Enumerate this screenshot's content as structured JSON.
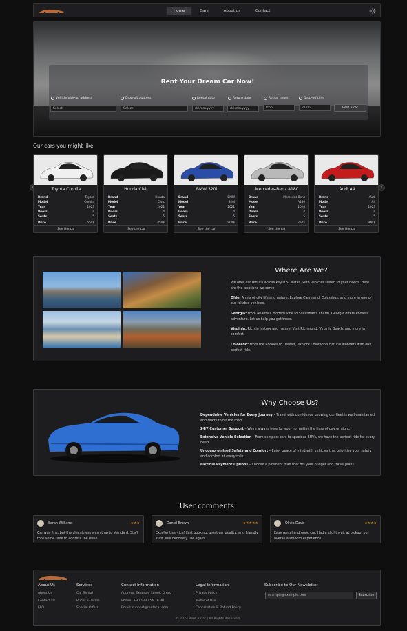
{
  "nav": {
    "links": [
      "Home",
      "Cars",
      "About us",
      "Contact"
    ],
    "active_index": 0
  },
  "hero": {
    "title": "Rent Your Dream Car Now!",
    "fields": [
      {
        "label": "Vehicle pick-up address",
        "value": "Select"
      },
      {
        "label": "Drop-off address",
        "value": "Select"
      },
      {
        "label": "Rental date",
        "value": "dd.mm.yyyy"
      },
      {
        "label": "Return date",
        "value": "dd.mm.yyyy"
      },
      {
        "label": "Rental hours",
        "value": "8:55"
      },
      {
        "label": "Drop-off time",
        "value": "21:05"
      }
    ],
    "button": "Rent a car"
  },
  "cars_section": {
    "heading": "Our cars you might like",
    "spec_labels": [
      "Brand",
      "Model",
      "Year",
      "Doors",
      "Seats",
      "Price"
    ],
    "see_label": "See the car",
    "cars": [
      {
        "name": "Toyota Corolla",
        "brand": "Toyota",
        "model": "Corolla",
        "year": "2023",
        "doors": "4",
        "seats": "5",
        "price": "550$",
        "color": "#f0f0f0"
      },
      {
        "name": "Honda Civic",
        "brand": "Honda",
        "model": "Civic",
        "year": "2022",
        "doors": "4",
        "seats": "5",
        "price": "450$",
        "color": "#1a1a1a"
      },
      {
        "name": "BMW 320i",
        "brand": "BMW",
        "model": "320i",
        "year": "2021",
        "doors": "4",
        "seats": "5",
        "price": "800$",
        "color": "#2a4ea8"
      },
      {
        "name": "Mercedes-Benz A180",
        "brand": "Mercedes-Benz",
        "model": "A180",
        "year": "2020",
        "doors": "4",
        "seats": "5",
        "price": "750$",
        "color": "#b9b9b9"
      },
      {
        "name": "Audi A4",
        "brand": "Audi",
        "model": "A4",
        "year": "2023",
        "doors": "4",
        "seats": "5",
        "price": "900$",
        "color": "#c41c1c"
      }
    ]
  },
  "where": {
    "heading": "Where Are We?",
    "intro": "We offer car rentals across key U.S. states, with vehicles suited to your needs. Here are the locations we serve:",
    "locations": [
      {
        "state": "Ohio:",
        "text": " A mix of city life and nature. Explore Cleveland, Columbus, and more in one of our reliable vehicles."
      },
      {
        "state": "Georgia:",
        "text": " From Atlanta's modern vibe to Savannah's charm, Georgia offers endless adventure. Let us help you get there."
      },
      {
        "state": "Virginia:",
        "text": " Rich in history and nature. Visit Richmond, Virginia Beach, and more in comfort."
      },
      {
        "state": "Colorado:",
        "text": " From the Rockies to Denver, explore Colorado's natural wonders with our perfect ride."
      }
    ]
  },
  "why": {
    "heading": "Why Choose Us?",
    "items": [
      {
        "title": "Dependable Vehicles for Every Journey",
        "text": " – Travel with confidence knowing our fleet is well-maintained and ready to hit the road."
      },
      {
        "title": "24/7 Customer Support",
        "text": " – We're always here for you, no matter the time of day or night."
      },
      {
        "title": "Extensive Vehicle Selection",
        "text": " – From compact cars to spacious SUVs, we have the perfect ride for every need."
      },
      {
        "title": "Uncompromised Safety and Comfort",
        "text": " – Enjoy peace of mind with vehicles that prioritize your safety and comfort at every mile."
      },
      {
        "title": "Flexible Payment Options",
        "text": " – Choose a payment plan that fits your budget and travel plans."
      }
    ]
  },
  "comments": {
    "heading": "User comments",
    "items": [
      {
        "name": "Sarah Williams",
        "stars": "★★★",
        "text": "Car was fine, but the cleanliness wasn't up to standard. Staff took some time to address the issue."
      },
      {
        "name": "Daniel Brown",
        "stars": "★★★★★",
        "text": "Excellent service! Fast booking, great car quality, and friendly staff. Will definitely use again."
      },
      {
        "name": "Olivia Davis",
        "stars": "★★★★",
        "text": "Easy rental and good car. Had a slight wait at pickup, but overall a smooth experience."
      }
    ]
  },
  "footer": {
    "about": {
      "heading": "About Us",
      "links": [
        "About Us",
        "Contact Us",
        "FAQ"
      ]
    },
    "services": {
      "heading": "Services",
      "links": [
        "Car Rental",
        "Prices & Terms",
        "Special Offers"
      ]
    },
    "contact": {
      "heading": "Contact Information",
      "lines": [
        "Address: Example Street, Ohaio",
        "Phone: +90 123 456 78 90",
        "Email: support@rentacar.com"
      ]
    },
    "legal": {
      "heading": "Legal Information",
      "links": [
        "Privacy Policy",
        "Terms of Use",
        "Cancellation & Refund Policy"
      ]
    },
    "newsletter": {
      "heading": "Subscribe to Our Newsletter",
      "placeholder": "example@example.com",
      "button": "Subscribe"
    },
    "copyright": "© 2024 Rent A Car | All Rights Reserved"
  }
}
